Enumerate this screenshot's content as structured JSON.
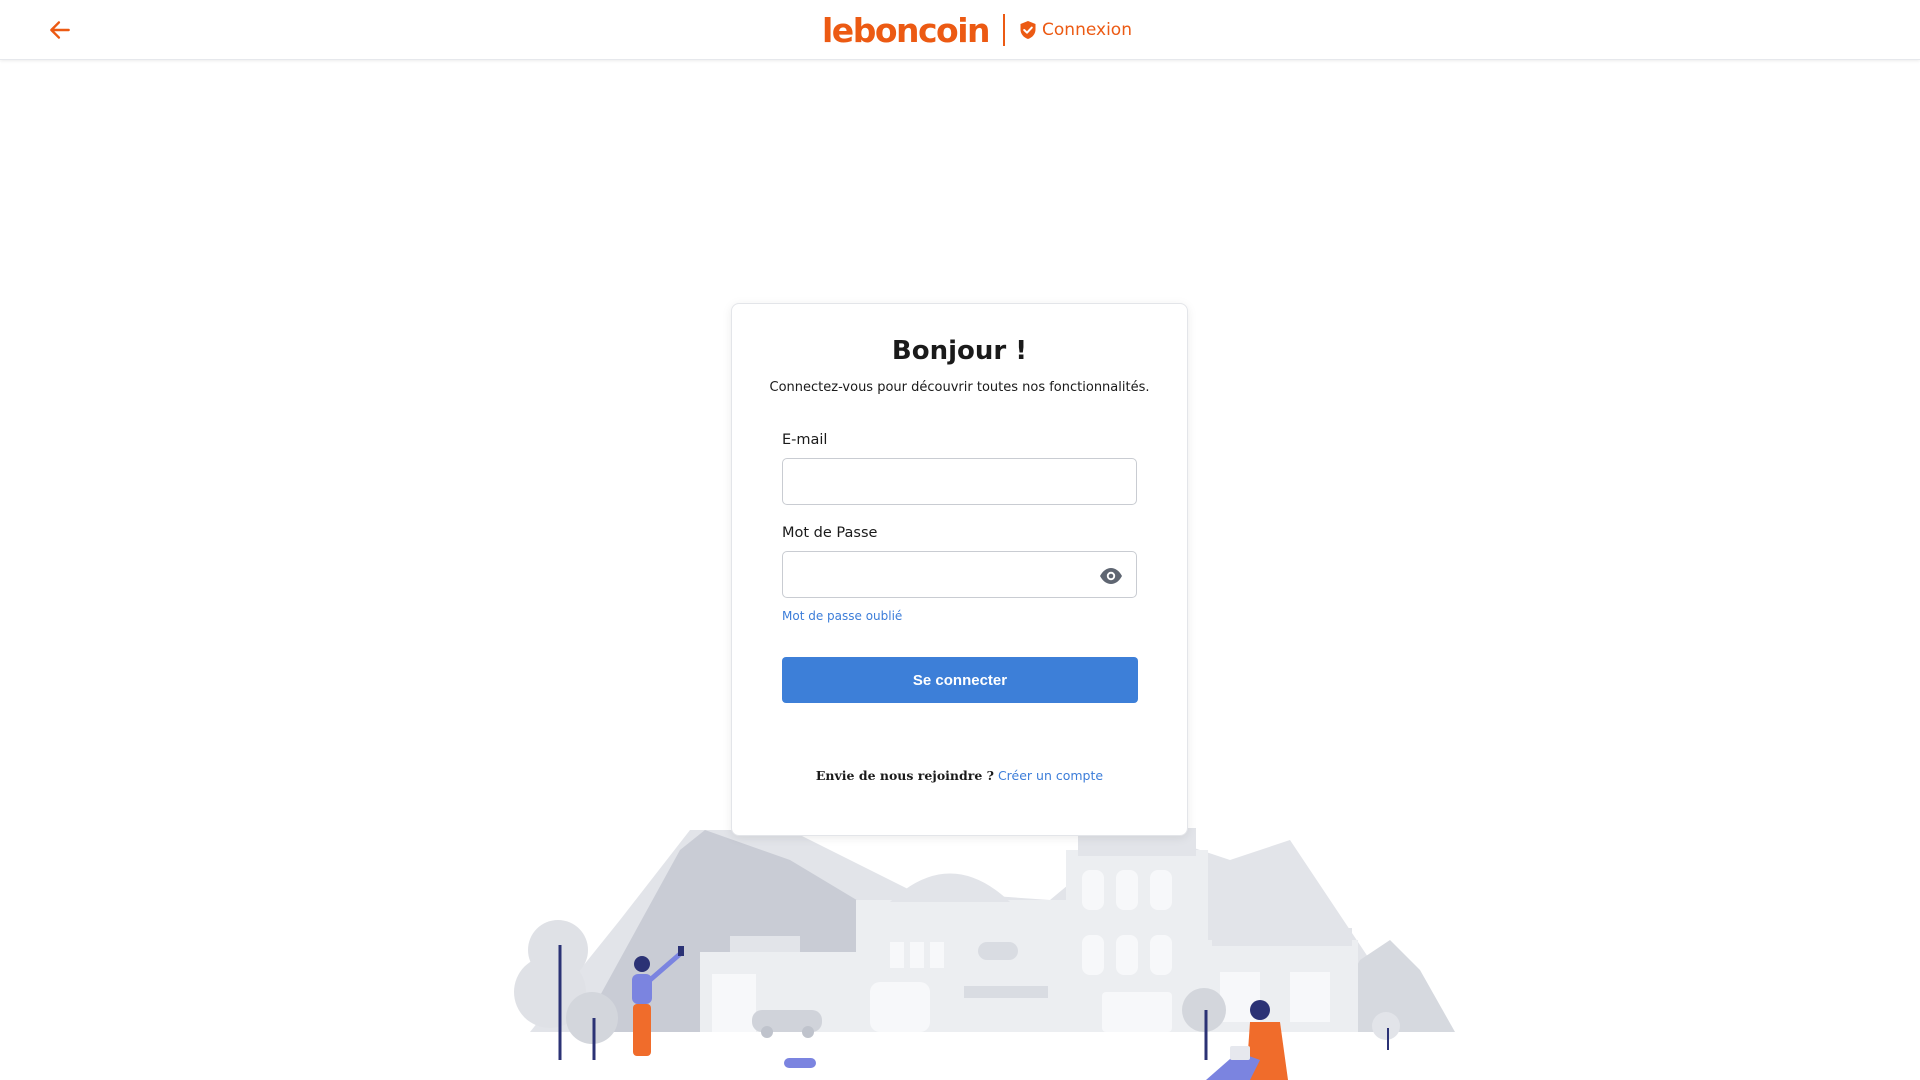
{
  "header": {
    "back_icon": "arrow-left-icon",
    "logo_text": "leboncoin",
    "section_icon": "shield-check-icon",
    "section_label": "Connexion",
    "accent_color": "#ec5a13"
  },
  "login": {
    "title": "Bonjour !",
    "subtitle": "Connectez-vous pour découvrir toutes nos fonctionnalités.",
    "email_label": "E-mail",
    "email_value": "",
    "password_label": "Mot de Passe",
    "password_value": "",
    "password_toggle_icon": "eye-icon",
    "forgot_label": "Mot de passe oublié",
    "submit_label": "Se connecter",
    "submit_color": "#3d7fd8",
    "join_question": "Envie de nous rejoindre ?",
    "join_link": "Créer un compte"
  }
}
